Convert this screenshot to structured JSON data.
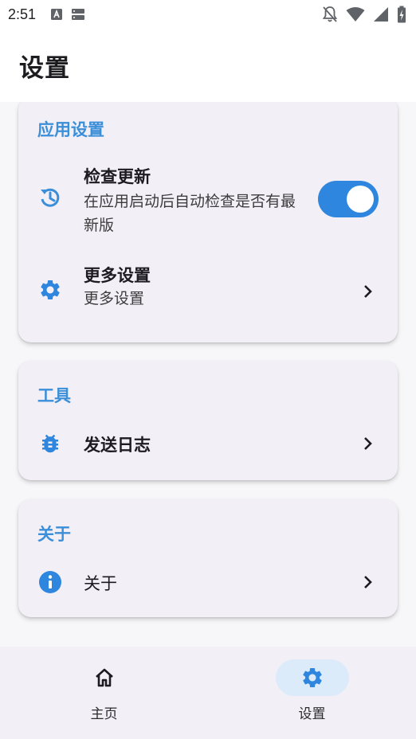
{
  "status_bar": {
    "time": "2:51"
  },
  "app_bar": {
    "title": "设置"
  },
  "sections": {
    "app_settings": {
      "title": "应用设置",
      "check_update": {
        "title": "检查更新",
        "subtitle_line1": "在应用启动后自动检查是否有最",
        "subtitle_line2": "新版",
        "enabled": true
      },
      "more_settings": {
        "title": "更多设置",
        "subtitle": "更多设置"
      }
    },
    "tools": {
      "title": "工具",
      "send_log": {
        "title": "发送日志"
      }
    },
    "about": {
      "title": "关于",
      "about_item": {
        "title": "关于"
      }
    }
  },
  "bottom_nav": {
    "items": [
      {
        "label": "主页",
        "icon": "home-icon",
        "active": false
      },
      {
        "label": "设置",
        "icon": "gear-icon",
        "active": true
      }
    ]
  },
  "colors": {
    "accent": "#2e86de",
    "section_title": "#3b8fd9",
    "card_bg": "#f3eff7",
    "nav_active": "#dcebfa"
  }
}
